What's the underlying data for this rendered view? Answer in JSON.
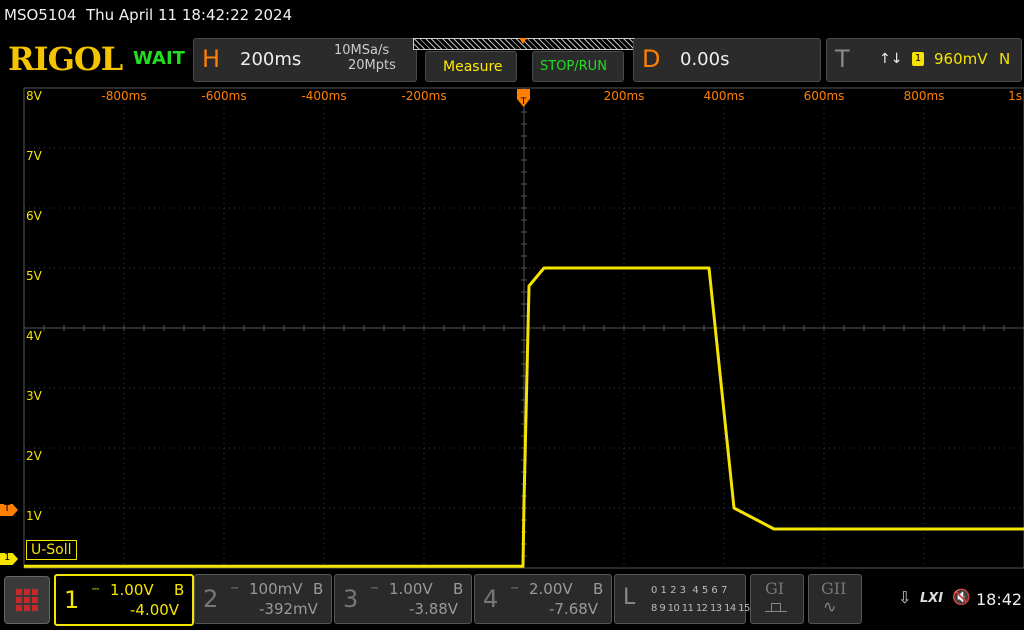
{
  "header": {
    "title": "MSO5104  Thu April 11 18:42:22 2024",
    "logo": "RIGOL",
    "status": "WAIT"
  },
  "horizontal": {
    "letter": "H",
    "timebase": "200ms",
    "sample_rate": "10MSa/s",
    "memory_depth": "20Mpts"
  },
  "buttons": {
    "measure": "Measure",
    "stop_run": "STOP/RUN"
  },
  "delay": {
    "letter": "D",
    "value": "0.00s"
  },
  "trigger": {
    "letter": "T",
    "edge_symbol": "↑↓",
    "source": "1",
    "level": "960mV",
    "mode": "N"
  },
  "grid": {
    "y_labels": [
      "8V",
      "7V",
      "6V",
      "5V",
      "4V",
      "3V",
      "2V",
      "1V"
    ],
    "x_labels": [
      "-800ms",
      "-600ms",
      "-400ms",
      "-200ms",
      "",
      "200ms",
      "400ms",
      "600ms",
      "800ms",
      "1s"
    ]
  },
  "markers": {
    "trigger_level": "T",
    "channel1": "1",
    "label": "U-Soll"
  },
  "channels": [
    {
      "num": "1",
      "scale": "1.00V",
      "coupling": "B",
      "offset": "-4.00V",
      "active": true
    },
    {
      "num": "2",
      "scale": "100mV",
      "coupling": "B",
      "offset": "-392mV",
      "active": false
    },
    {
      "num": "3",
      "scale": "1.00V",
      "coupling": "B",
      "offset": "-3.88V",
      "active": false
    },
    {
      "num": "4",
      "scale": "2.00V",
      "coupling": "B",
      "offset": "-7.68V",
      "active": false
    }
  ],
  "logic": {
    "letter": "L",
    "row1": "0 1 2 3  4 5 6 7",
    "row2": "8 9 10 11 12 13 14 15"
  },
  "generators": [
    "GI",
    "GII"
  ],
  "system": {
    "lxi": "LXI",
    "time": "18:42"
  },
  "colors": {
    "ch1": "#f5e400",
    "accent": "#ff7f00",
    "status": "#22dd22",
    "grid": "#3a3a3a"
  },
  "chart_data": {
    "type": "line",
    "xlabel": "",
    "ylabel": "",
    "xlim": [
      -1.0,
      1.0
    ],
    "ylim": [
      0,
      8
    ],
    "series": [
      {
        "x": [
          -1.0,
          -0.002,
          0.0,
          0.01,
          0.04,
          0.37,
          0.42,
          0.5,
          1.0
        ],
        "y": [
          0.03,
          0.03,
          1.1,
          4.7,
          5.0,
          5.0,
          1.0,
          0.65,
          0.65
        ]
      }
    ]
  }
}
